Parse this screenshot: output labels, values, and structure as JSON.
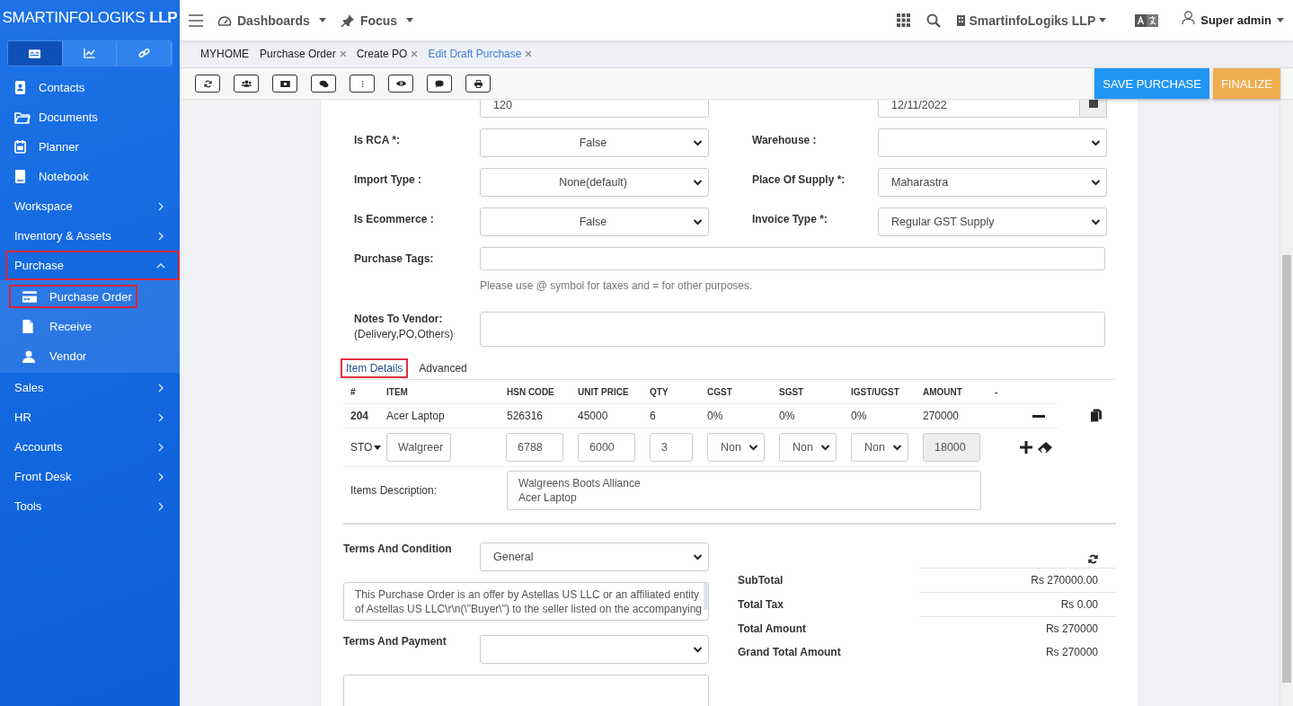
{
  "brand": {
    "name": "SMARTINFOLOGIKS",
    "suffix": "LLP"
  },
  "sidebar": {
    "switcher": [
      {
        "selected": true
      },
      {
        "selected": false
      },
      {
        "selected": false
      }
    ],
    "items": [
      {
        "kind": "link",
        "label": "Contacts"
      },
      {
        "kind": "link",
        "label": "Documents"
      },
      {
        "kind": "link",
        "label": "Planner"
      },
      {
        "kind": "link",
        "label": "Notebook"
      },
      {
        "kind": "group",
        "label": "Workspace",
        "expanded": false
      },
      {
        "kind": "group",
        "label": "Inventory & Assets",
        "expanded": false
      },
      {
        "kind": "group",
        "label": "Purchase",
        "expanded": true,
        "highlighted": true,
        "children": [
          {
            "label": "Purchase Order",
            "highlighted": true
          },
          {
            "label": "Receive",
            "highlighted": false
          },
          {
            "label": "Vendor",
            "highlighted": false
          }
        ]
      },
      {
        "kind": "group",
        "label": "Sales",
        "expanded": false
      },
      {
        "kind": "group",
        "label": "HR",
        "expanded": false
      },
      {
        "kind": "group",
        "label": "Accounts",
        "expanded": false
      },
      {
        "kind": "group",
        "label": "Front Desk",
        "expanded": false
      },
      {
        "kind": "group",
        "label": "Tools",
        "expanded": false
      }
    ]
  },
  "topbar": {
    "nav": [
      "Dashboards",
      "Focus"
    ],
    "company": "SmartinfoLogiks LLP",
    "user": "Super admin"
  },
  "tabs": [
    {
      "label": "MYHOME",
      "selected": false,
      "closable": false
    },
    {
      "label": "Purchase Order",
      "selected": false,
      "closable": true
    },
    {
      "label": "Create PO",
      "selected": false,
      "closable": true
    },
    {
      "label": "Edit Draft Purchase",
      "selected": true,
      "closable": true
    }
  ],
  "actions": [
    {
      "label": "SAVE PURCHASE",
      "kind": "primary"
    },
    {
      "label": "FINALIZE",
      "kind": "warning"
    }
  ],
  "form": {
    "partial_row": [
      {
        "value": "120",
        "kind": "text"
      },
      {
        "value": "12/11/2022",
        "kind": "date"
      }
    ],
    "rows": [
      [
        {
          "label": "Is RCA *:",
          "value": "False"
        },
        {
          "label": "Warehouse :"
        }
      ],
      [
        {
          "label": "Import Type :",
          "value": "None(default)"
        },
        {
          "label": "Place Of Supply *:",
          "value": "Maharastra"
        }
      ],
      [
        {
          "label": "Is Ecommerce :",
          "value": "False"
        },
        {
          "label": "Invoice Type *:",
          "value": "Regular GST Supply"
        }
      ]
    ],
    "purchase_tags": {
      "label": "Purchase Tags:",
      "hint": "Please use @ symbol for taxes and = for other purposes."
    },
    "notes": {
      "label": "Notes To Vendor:",
      "sublabel": "(Delivery,PO,Others)"
    }
  },
  "item_tabs": [
    {
      "label": "Item Details",
      "selected": true,
      "highlighted": true
    },
    {
      "label": "Advanced",
      "selected": false,
      "highlighted": false
    }
  ],
  "items_table": {
    "columns": [
      "#",
      "ITEM",
      "HSN CODE",
      "UNIT PRICE",
      "QTY",
      "CGST",
      "SGST",
      "IGST/UGST",
      "AMOUNT",
      "-"
    ],
    "rows": [
      {
        "cells": [
          "204",
          "Acer Laptop",
          "526316",
          "45000",
          "6",
          "0%",
          "0%",
          "0%",
          "270000"
        ]
      }
    ],
    "entry": {
      "type": "STO",
      "item": "Walgreer",
      "hsn": "6788",
      "price": "6000",
      "qty": "3",
      "taxes": [
        "Non",
        "Non",
        "Non"
      ],
      "amount": "18000"
    },
    "description": {
      "label": "Items Description:",
      "lines": [
        "Walgreens Boots Alliance",
        "Acer Laptop"
      ]
    }
  },
  "terms": {
    "label": "Terms And Condition",
    "value": "General",
    "lines": [
      "This Purchase Order is an offer by Astellas US LLC or an affiliated entity",
      "of Astellas US LLC\\r\\n(\\\"Buyer\\\") to the seller listed on the accompanying"
    ]
  },
  "payment": {
    "label": "Terms And Payment"
  },
  "totals": [
    {
      "label": "SubTotal",
      "value": "Rs 270000.00"
    },
    {
      "label": "Total Tax",
      "value": "Rs 0.00"
    },
    {
      "label": "Total Amount",
      "value": "Rs 270000"
    },
    {
      "label": "Grand Total Amount",
      "value": "Rs 270000"
    }
  ]
}
